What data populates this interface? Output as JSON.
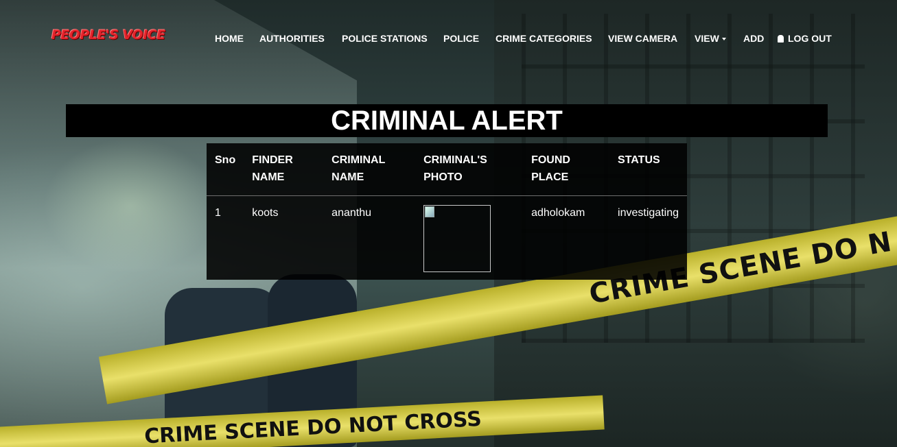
{
  "brand": {
    "logo_text": "PEOPLE'S VOICE"
  },
  "nav": {
    "items": [
      {
        "label": "HOME"
      },
      {
        "label": "AUTHORITIES"
      },
      {
        "label": "POLICE STATIONS"
      },
      {
        "label": "POLICE"
      },
      {
        "label": "CRIME CATEGORIES"
      },
      {
        "label": "VIEW CAMERA"
      },
      {
        "label": "VIEW",
        "dropdown": true
      },
      {
        "label": "ADD"
      },
      {
        "label": "LOG OUT",
        "icon": "user-icon"
      }
    ]
  },
  "page": {
    "title": "CRIMINAL ALERT"
  },
  "table": {
    "headers": {
      "sno": "Sno",
      "finder_name": "FINDER NAME",
      "criminal_name": "CRIMINAL NAME",
      "criminal_photo": "CRIMINAL'S PHOTO",
      "found_place": "FOUND PLACE",
      "status": "STATUS"
    },
    "rows": [
      {
        "sno": "1",
        "finder_name": "koots",
        "criminal_name": "ananthu",
        "criminal_photo": "broken-image-icon",
        "found_place": "adholokam",
        "status": "investigating"
      }
    ]
  },
  "background": {
    "tape_text_1": "CRIME SCENE DO N",
    "tape_text_2": "CRIME SCENE DO NOT CROSS"
  }
}
